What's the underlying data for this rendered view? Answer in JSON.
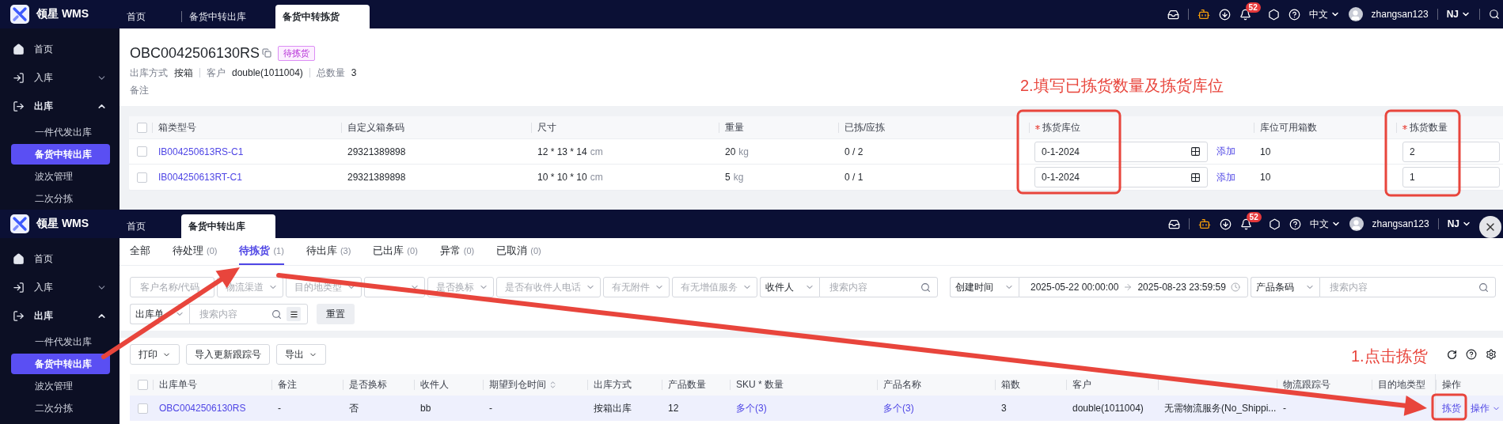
{
  "top_screen": {
    "nav": {
      "logo": "领星 WMS",
      "tabs": [
        {
          "label": "首页",
          "selected": false
        },
        {
          "label": "备货中转出库",
          "selected": false
        },
        {
          "label": "备货中转拣货",
          "selected": true
        }
      ],
      "notification_count": "52",
      "language": "中文",
      "user": "zhangsan123",
      "warehouse": "NJ"
    },
    "sidebar": {
      "items": [
        {
          "kind": "link",
          "label": "首页"
        },
        {
          "kind": "group",
          "label": "入库",
          "expanded": false
        },
        {
          "kind": "group",
          "label": "出库",
          "expanded": true,
          "children": [
            {
              "label": "一件代发出库",
              "selected": false
            },
            {
              "label": "备货中转出库",
              "selected": true
            },
            {
              "label": "波次管理",
              "selected": false
            },
            {
              "label": "二次分拣",
              "selected": false
            }
          ]
        }
      ]
    },
    "order": {
      "number": "OBC0042506130RS",
      "status": "待拣货",
      "meta": [
        {
          "label": "出库方式",
          "value": "按箱"
        },
        {
          "label": "客户",
          "value": "double(1011004)"
        },
        {
          "label": "总数量",
          "value": "3"
        }
      ],
      "remark_label": "备注"
    },
    "box_table": {
      "header_checked": false,
      "columns": [
        {
          "label": "箱类型号",
          "required": false
        },
        {
          "label": "自定义箱条码",
          "required": false
        },
        {
          "label": "尺寸",
          "required": false
        },
        {
          "label": "重量",
          "required": false
        },
        {
          "label": "已拣/应拣",
          "required": false
        },
        {
          "label": "拣货库位",
          "required": true
        },
        {
          "label": "库位可用箱数",
          "required": false
        },
        {
          "label": "拣货数量",
          "required": true
        }
      ],
      "rows": [
        {
          "checked": false,
          "box_type": "IB004250613RS-C1",
          "box_barcode": "29321389898",
          "size": "12 * 13 * 14",
          "size_unit": "cm",
          "weight": "20",
          "weight_unit": "kg",
          "picked": "0 / 2",
          "location": "0-1-2024",
          "add_link": "添加",
          "available_boxes": "10",
          "pick_quantity": "2"
        },
        {
          "checked": false,
          "box_type": "IB004250613RT-C1",
          "box_barcode": "29321389898",
          "size": "10 * 10 * 10",
          "size_unit": "cm",
          "weight": "5",
          "weight_unit": "kg",
          "picked": "0 / 1",
          "location": "0-1-2024",
          "add_link": "添加",
          "available_boxes": "10",
          "pick_quantity": "1"
        }
      ]
    },
    "annotation": "2.填写已拣货数量及拣货库位"
  },
  "bottom_screen": {
    "nav": {
      "logo": "领星 WMS",
      "tabs": [
        {
          "label": "首页",
          "selected": false
        },
        {
          "label": "备货中转出库",
          "selected": true
        }
      ],
      "notification_count": "52",
      "language": "中文",
      "user": "zhangsan123",
      "warehouse": "NJ"
    },
    "sidebar": {
      "items": [
        {
          "kind": "link",
          "label": "首页"
        },
        {
          "kind": "group",
          "label": "入库",
          "expanded": false
        },
        {
          "kind": "group",
          "label": "出库",
          "expanded": true,
          "children": [
            {
              "label": "一件代发出库",
              "selected": false
            },
            {
              "label": "备货中转出库",
              "selected": true
            },
            {
              "label": "波次管理",
              "selected": false
            },
            {
              "label": "二次分拣",
              "selected": false
            }
          ]
        }
      ]
    },
    "status_tabs": [
      {
        "label": "全部",
        "selected": false
      },
      {
        "label": "待处理",
        "count": "(0)",
        "selected": false
      },
      {
        "label": "待拣货",
        "count": "(1)",
        "selected": true
      },
      {
        "label": "待出库",
        "count": "(3)",
        "selected": false
      },
      {
        "label": "已出库",
        "count": "(0)",
        "selected": false
      },
      {
        "label": "异常",
        "count": "(0)",
        "selected": false
      },
      {
        "label": "已取消",
        "count": "(0)",
        "selected": false
      }
    ],
    "filter_rows": [
      [
        {
          "kind": "input",
          "placeholder": "客户名称/代码"
        },
        {
          "kind": "select",
          "placeholder": "物流渠道"
        },
        {
          "kind": "select",
          "placeholder": "目的地类型"
        },
        {
          "kind": "select"
        },
        {
          "kind": "select",
          "placeholder": "是否换标"
        },
        {
          "kind": "select",
          "placeholder": "是否有收件人电话"
        },
        {
          "kind": "select",
          "placeholder": "有无附件"
        },
        {
          "kind": "select",
          "placeholder": "有无增值服务"
        },
        {
          "kind": "select-search",
          "select": "收件人",
          "placeholder": "搜索内容",
          "menu": false
        },
        {
          "kind": "date-range",
          "select": "创建时间",
          "start": "2025-05-22 00:00:00",
          "end": "2025-08-23 23:59:59"
        },
        {
          "kind": "select-search",
          "select": "产品条码",
          "placeholder": "搜索内容",
          "menu": false
        }
      ],
      [
        {
          "kind": "select-search",
          "select": "出库单",
          "placeholder": "搜索内容",
          "menu": true
        },
        {
          "kind": "button",
          "label": "重置"
        }
      ]
    ],
    "toolbar": {
      "buttons": [
        {
          "label": "打印",
          "dropdown": true
        },
        {
          "label": "导入更新跟踪号",
          "dropdown": false
        },
        {
          "label": "导出",
          "dropdown": true
        }
      ]
    },
    "orders_table": {
      "header_checked": false,
      "columns": [
        {
          "label": "出库单号",
          "sortable": false
        },
        {
          "label": "备注",
          "sortable": false
        },
        {
          "label": "是否换标",
          "sortable": false
        },
        {
          "label": "收件人",
          "sortable": false
        },
        {
          "label": "期望到仓时间",
          "sortable": true
        },
        {
          "label": "出库方式",
          "sortable": false
        },
        {
          "label": "产品数量",
          "sortable": false
        },
        {
          "label": "SKU * 数量",
          "sortable": false
        },
        {
          "label": "产品名称",
          "sortable": false
        },
        {
          "label": "箱数",
          "sortable": false
        },
        {
          "label": "客户",
          "sortable": false
        },
        {
          "sortable": false
        },
        {
          "label": "物流跟踪号",
          "sortable": false
        },
        {
          "label": "目的地类型",
          "sortable": false
        },
        {
          "label": "操作",
          "sortable": false
        }
      ],
      "rows": [
        {
          "checked": false,
          "highlighted": true,
          "cells": [
            {
              "kind": "link",
              "text": "OBC0042506130RS"
            },
            {
              "kind": "text",
              "text": "-"
            },
            {
              "kind": "text",
              "text": "否"
            },
            {
              "kind": "text",
              "text": "bb"
            },
            {
              "kind": "text",
              "text": "-"
            },
            {
              "kind": "text",
              "text": "按箱出库"
            },
            {
              "kind": "text",
              "text": "12"
            },
            {
              "kind": "link",
              "text": "多个(3)"
            },
            {
              "kind": "link",
              "text": "多个(3)"
            },
            {
              "kind": "text",
              "text": "3"
            },
            {
              "kind": "text",
              "text": "double(1011004)"
            },
            {
              "kind": "text",
              "text": "无需物流服务(No_Shippi..."
            },
            {
              "kind": "text",
              "text": "-"
            }
          ],
          "actions": [
            {
              "label": "拣货",
              "dropdown": false
            },
            {
              "label": "操作",
              "dropdown": true
            }
          ]
        }
      ]
    },
    "annotation": "1.点击拣货"
  }
}
